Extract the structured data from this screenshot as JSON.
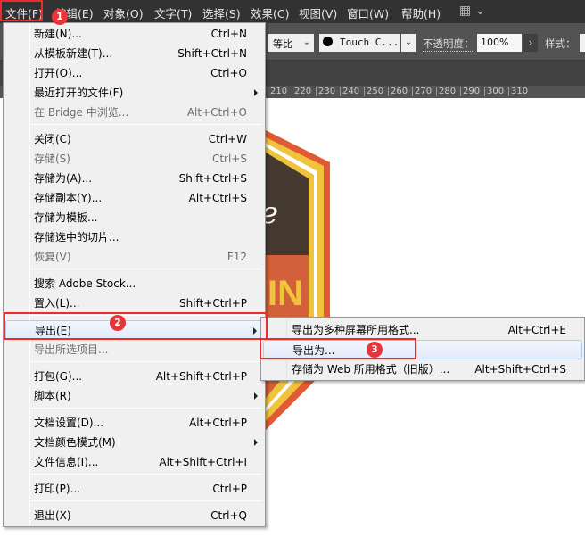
{
  "menubar": {
    "items": [
      "文件(F)",
      "编辑(E)",
      "对象(O)",
      "文字(T)",
      "选择(S)",
      "效果(C)",
      "视图(V)",
      "窗口(W)",
      "帮助(H)"
    ]
  },
  "toolbar": {
    "stroke_profile": "等比",
    "brush": "Touch C...",
    "opacity_label": "不透明度：",
    "opacity_value": "100%",
    "style_label": "样式："
  },
  "ruler": {
    "ticks": [
      "210",
      "220",
      "230",
      "240",
      "250",
      "260",
      "270",
      "280",
      "290",
      "300",
      "310"
    ]
  },
  "file_menu": {
    "items": [
      {
        "label": "新建(N)...",
        "shortcut": "Ctrl+N"
      },
      {
        "label": "从模板新建(T)...",
        "shortcut": "Shift+Ctrl+N"
      },
      {
        "label": "打开(O)...",
        "shortcut": "Ctrl+O"
      },
      {
        "label": "最近打开的文件(F)",
        "shortcut": "",
        "submenu": true
      },
      {
        "label": "在 Bridge 中浏览...",
        "shortcut": "Alt+Ctrl+O",
        "disabled": true
      },
      {
        "label": "关闭(C)",
        "shortcut": "Ctrl+W"
      },
      {
        "label": "存储(S)",
        "shortcut": "Ctrl+S",
        "disabled": true
      },
      {
        "label": "存储为(A)...",
        "shortcut": "Shift+Ctrl+S"
      },
      {
        "label": "存储副本(Y)...",
        "shortcut": "Alt+Ctrl+S"
      },
      {
        "label": "存储为模板...",
        "shortcut": ""
      },
      {
        "label": "存储选中的切片...",
        "shortcut": ""
      },
      {
        "label": "恢复(V)",
        "shortcut": "F12",
        "disabled": true
      },
      {
        "label": "搜索 Adobe Stock...",
        "shortcut": ""
      },
      {
        "label": "置入(L)...",
        "shortcut": "Shift+Ctrl+P"
      },
      {
        "label": "导出(E)",
        "shortcut": "",
        "submenu": true,
        "highlight": true
      },
      {
        "label": "导出所选项目...",
        "shortcut": "",
        "disabled": true
      },
      {
        "label": "打包(G)...",
        "shortcut": "Alt+Shift+Ctrl+P"
      },
      {
        "label": "脚本(R)",
        "shortcut": "",
        "submenu": true
      },
      {
        "label": "文档设置(D)...",
        "shortcut": "Alt+Ctrl+P"
      },
      {
        "label": "文档颜色模式(M)",
        "shortcut": "",
        "submenu": true
      },
      {
        "label": "文件信息(I)...",
        "shortcut": "Alt+Shift+Ctrl+I"
      },
      {
        "label": "打印(P)...",
        "shortcut": "Ctrl+P"
      },
      {
        "label": "退出(X)",
        "shortcut": "Ctrl+Q"
      }
    ]
  },
  "export_submenu": {
    "items": [
      {
        "label": "导出为多种屏幕所用格式...",
        "shortcut": "Alt+Ctrl+E"
      },
      {
        "label": "导出为...",
        "shortcut": "",
        "highlight": true
      },
      {
        "label": "存储为 Web 所用格式（旧版）...",
        "shortcut": "Alt+Shift+Ctrl+S"
      }
    ]
  },
  "badges": [
    "1",
    "2",
    "3"
  ],
  "colors": {
    "highlight_box": "#ee2b2b",
    "badge": "#e8353a"
  }
}
